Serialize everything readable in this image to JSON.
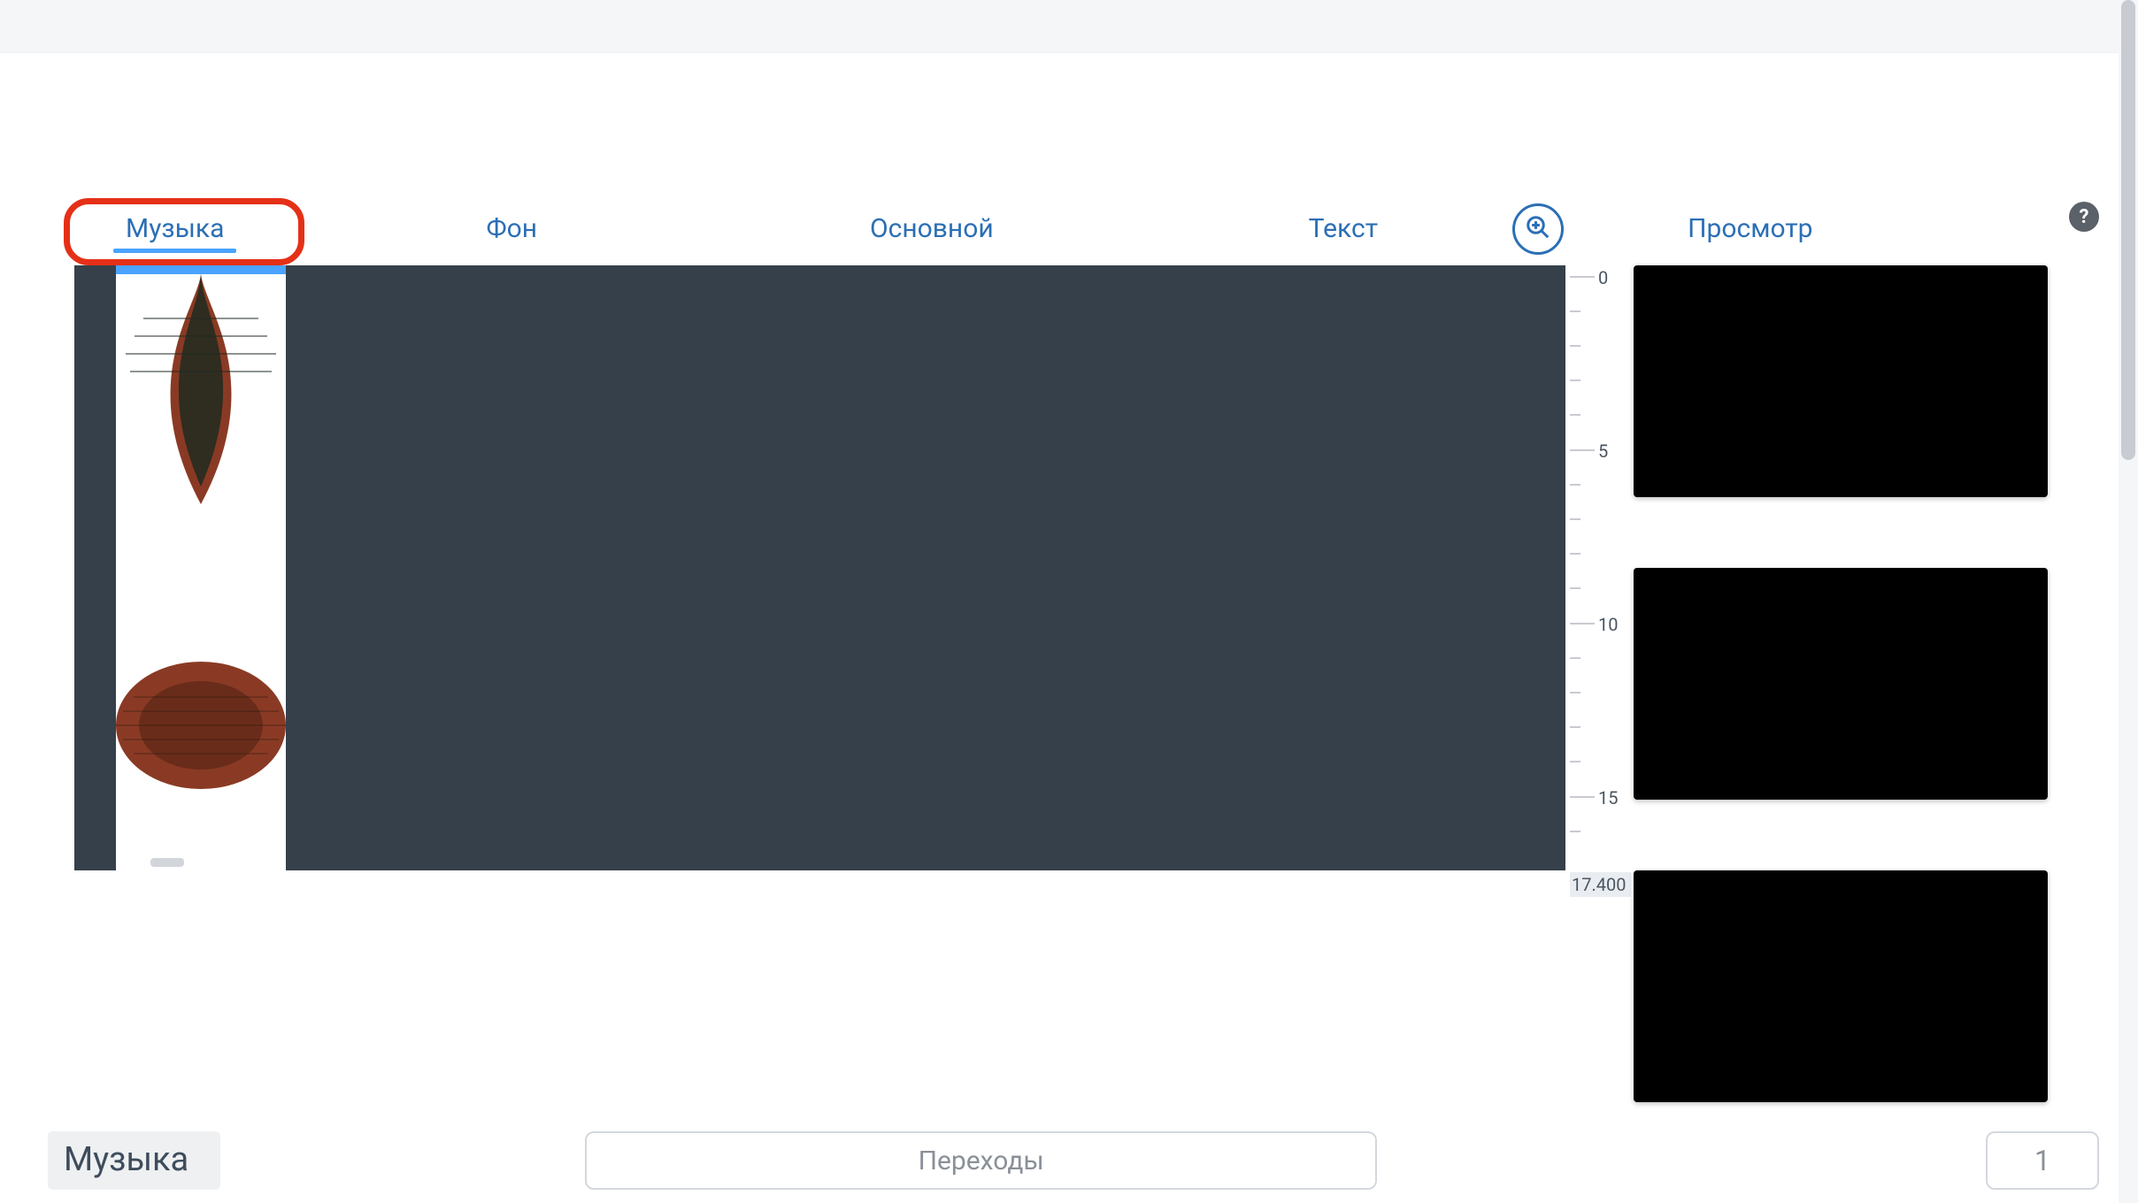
{
  "tabs": {
    "music": "Музыка",
    "background": "Фон",
    "main": "Основной",
    "text": "Текст",
    "preview": "Просмотр"
  },
  "active_tab": "music",
  "ruler": {
    "major_labels": [
      "0",
      "5",
      "10",
      "15"
    ],
    "end": "17.400"
  },
  "bottom": {
    "section_label": "Музыка",
    "transitions_label": "Переходы",
    "item_count": "1"
  },
  "icons": {
    "zoom": "zoom-in-icon",
    "help": "help-icon"
  },
  "preview_thumbs": 3
}
